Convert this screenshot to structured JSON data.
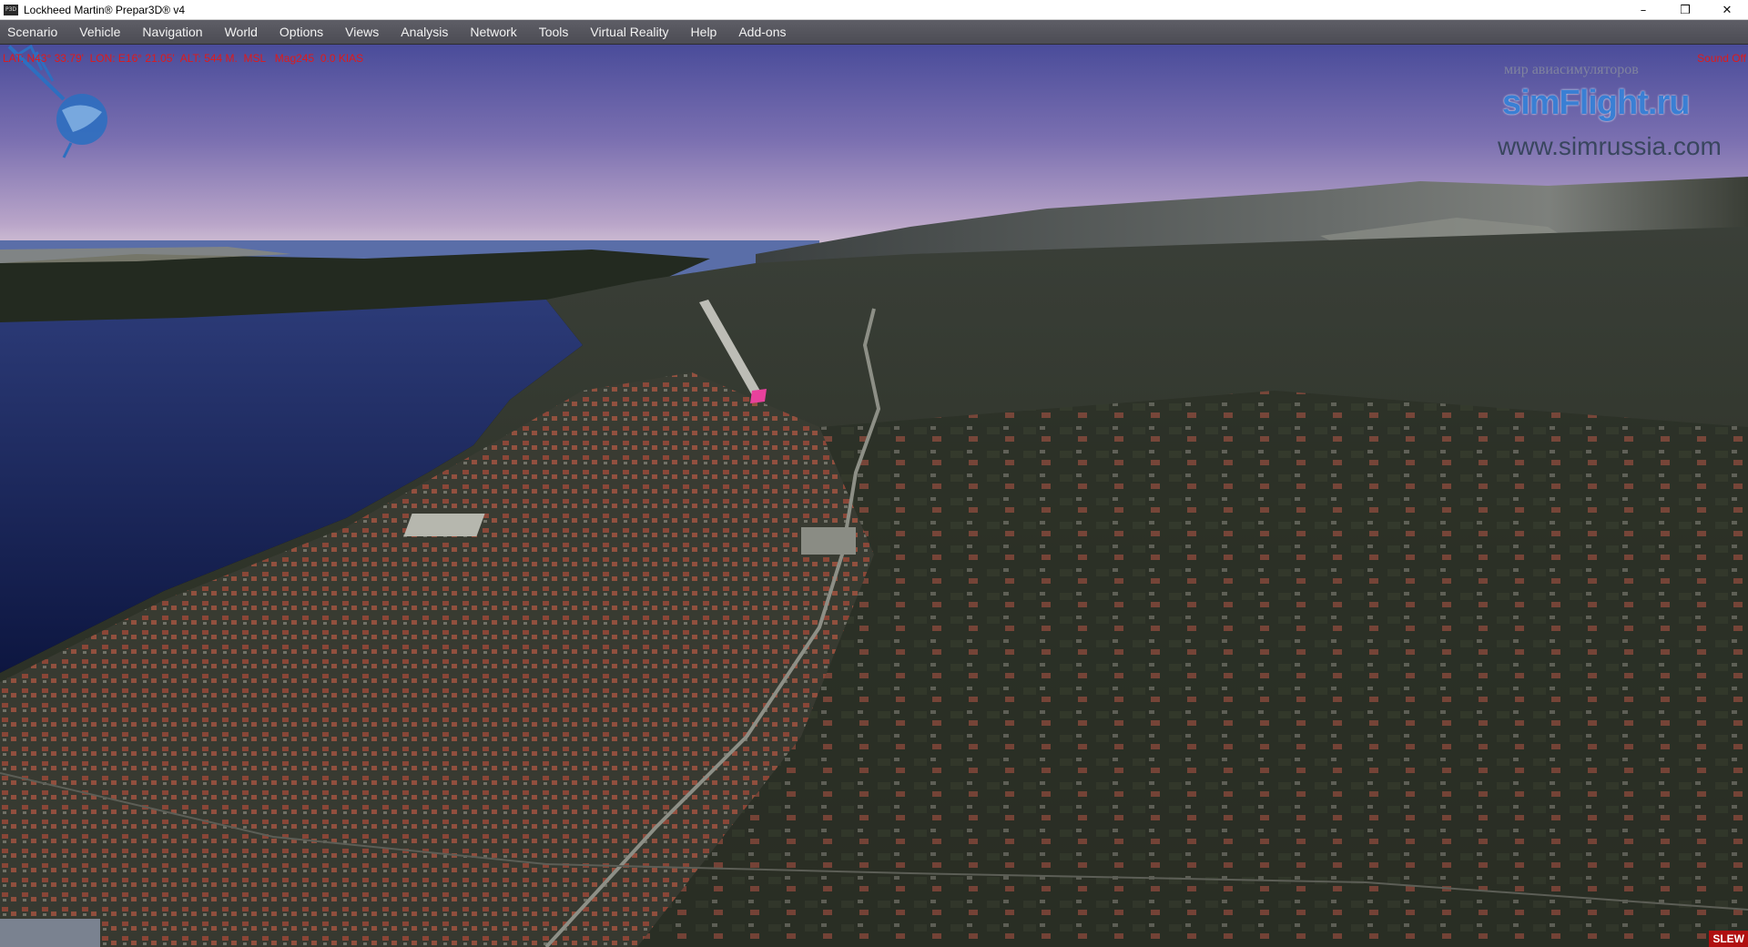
{
  "window": {
    "title": "Lockheed Martin® Prepar3D® v4",
    "icon": "p3d-app-icon",
    "controls": {
      "minimize": "–",
      "restore": "❒",
      "close": "✕"
    }
  },
  "menu": [
    {
      "label": "Scenario"
    },
    {
      "label": "Vehicle"
    },
    {
      "label": "Navigation"
    },
    {
      "label": "World"
    },
    {
      "label": "Options"
    },
    {
      "label": "Views"
    },
    {
      "label": "Analysis"
    },
    {
      "label": "Network"
    },
    {
      "label": "Tools"
    },
    {
      "label": "Virtual Reality"
    },
    {
      "label": "Help"
    },
    {
      "label": "Add-ons"
    }
  ],
  "hud": {
    "readout": "LAT: N43° 33.79'  LON: E16° 21.05'  ALT: 544 M.  MSL   Mag245  0.0 KIAS",
    "sound": "Sound Off",
    "slew": "SLEW",
    "color": "#e01a1a"
  },
  "watermark": {
    "tagline": "мир авиасимуляторов",
    "brand": "simFlight.ru",
    "url": "www.simrussia.com",
    "brand_color": "#3a7fd4"
  }
}
